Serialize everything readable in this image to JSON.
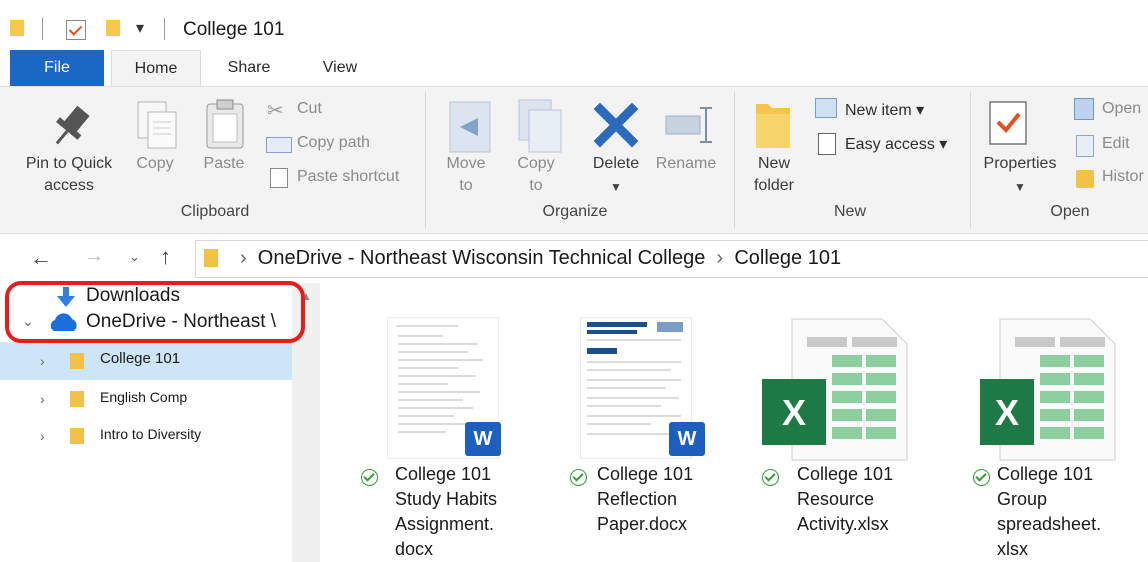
{
  "window": {
    "title": "College 101"
  },
  "tabs": {
    "file": "File",
    "home": "Home",
    "share": "Share",
    "view": "View"
  },
  "ribbon": {
    "clipboard": {
      "group": "Clipboard",
      "pin_line1": "Pin to Quick",
      "pin_line2": "access",
      "copy": "Copy",
      "paste": "Paste",
      "cut": "Cut",
      "copy_path": "Copy path",
      "paste_shortcut": "Paste shortcut"
    },
    "organize": {
      "group": "Organize",
      "move_line1": "Move",
      "move_line2": "to",
      "copy_line1": "Copy",
      "copy_line2": "to",
      "delete": "Delete",
      "rename": "Rename"
    },
    "new": {
      "group": "New",
      "folder_line1": "New",
      "folder_line2": "folder",
      "new_item": "New item",
      "easy_access": "Easy access"
    },
    "open": {
      "group": "Open",
      "properties": "Properties",
      "open": "Open",
      "edit": "Edit",
      "history": "Histor"
    }
  },
  "address": {
    "root": "OneDrive - Northeast Wisconsin Technical College",
    "current": "College 101"
  },
  "nav": {
    "downloads": "Downloads",
    "onedrive": "OneDrive - Northeast \\",
    "folders": [
      "College 101",
      "English Comp",
      "Intro to Diversity"
    ]
  },
  "files": [
    {
      "name": "College 101\nStudy Habits\nAssignment.\ndocx",
      "type": "word",
      "synced": true
    },
    {
      "name": "College 101\nReflection\nPaper.docx",
      "type": "word",
      "synced": true
    },
    {
      "name": "College 101\nResource\nActivity.xlsx",
      "type": "excel",
      "synced": true
    },
    {
      "name": "College 101\nGroup\nspreadsheet.\nxlsx",
      "type": "excel",
      "synced": true
    }
  ],
  "colors": {
    "file_tab": "#1a68c4",
    "highlight": "#e41d1d",
    "excel": "#1d7a45",
    "word": "#1d5fbe",
    "selection": "#cde6f7"
  }
}
